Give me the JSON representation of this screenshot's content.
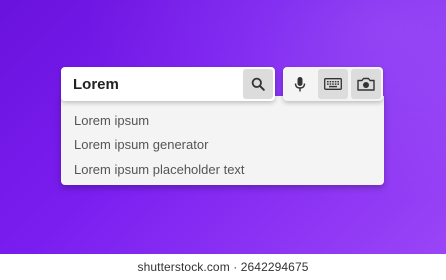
{
  "search": {
    "query": "Lorem"
  },
  "suggestions": [
    "Lorem ipsum",
    "Lorem ipsum generator",
    "Lorem ipsum placeholder text"
  ],
  "icons": {
    "search": "search-icon",
    "voice": "microphone-icon",
    "keyboard": "keyboard-icon",
    "camera": "camera-icon"
  },
  "colors": {
    "background_start": "#6a12dd",
    "background_end": "#9a45f7",
    "button_gray": "#dcdcdc",
    "panel": "#f4f4f4"
  },
  "watermark": "shutterstock.com · 2642294675"
}
